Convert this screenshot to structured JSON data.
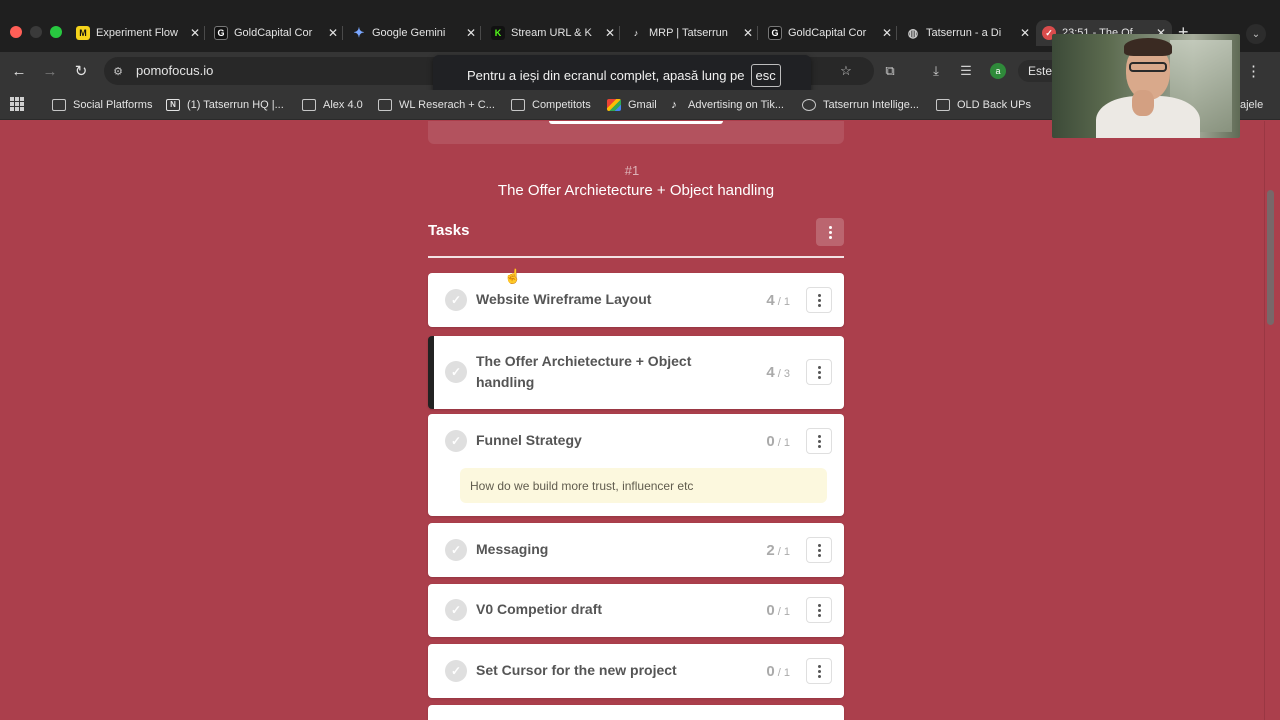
{
  "browser": {
    "tabs": [
      {
        "title": "Experiment Flow",
        "favicon": "miro-icon",
        "fav_bg": "#f5d31b",
        "fav_txt": "M",
        "active": false
      },
      {
        "title": "GoldCapital Cor",
        "favicon": "goldcapital-icon",
        "fav_bg": "#111111",
        "fav_txt": "G",
        "active": false
      },
      {
        "title": "Google Gemini",
        "favicon": "gemini-icon",
        "fav_bg": "#1f1f1f",
        "fav_txt": "✦",
        "active": false
      },
      {
        "title": "Stream URL & K",
        "favicon": "kick-icon",
        "fav_bg": "#111111",
        "fav_txt": "K",
        "active": false
      },
      {
        "title": "MRP | Tatserrun",
        "favicon": "tiktok-icon",
        "fav_bg": "#111111",
        "fav_txt": "♪",
        "active": false
      },
      {
        "title": "GoldCapital Cor",
        "favicon": "goldcapital-icon",
        "fav_bg": "#111111",
        "fav_txt": "G",
        "active": false
      },
      {
        "title": "Tatserrun - a Di",
        "favicon": "globe-icon",
        "fav_bg": "#1f1f1f",
        "fav_txt": "◍",
        "active": false
      },
      {
        "title": "23:51 - The Of",
        "favicon": "pomofocus-icon",
        "fav_bg": "#d94c4c",
        "fav_txt": "✓",
        "active": true
      }
    ],
    "url": "pomofocus.io",
    "fullscreen_notice": "Pentru a ieși din ecranul complet, apasă lung pe",
    "fullscreen_key": "esc",
    "profile_label": "Este",
    "bookmarks": [
      {
        "label": "Social Platforms",
        "icon": "folder"
      },
      {
        "label": "(1) Tatserrun HQ |...",
        "icon": "notion"
      },
      {
        "label": "Alex 4.0",
        "icon": "folder"
      },
      {
        "label": "WL Reserach + C...",
        "icon": "folder"
      },
      {
        "label": "Competitots",
        "icon": "folder"
      },
      {
        "label": "Gmail",
        "icon": "gmail"
      },
      {
        "label": "Advertising on Tik...",
        "icon": "tiktok"
      },
      {
        "label": "Tatserrun Intellige...",
        "icon": "globe"
      },
      {
        "label": "OLD Back UPs",
        "icon": "folder"
      },
      {
        "label": "ajele",
        "icon": "none"
      }
    ]
  },
  "app": {
    "session_number": "#1",
    "current_task": "The Offer Archietecture + Object handling",
    "tasks_title": "Tasks",
    "tasks": [
      {
        "name": "Website Wireframe Layout",
        "done": "4",
        "est": "/ 1",
        "note": ""
      },
      {
        "name": "The Offer Archietecture + Object handling",
        "done": "4",
        "est": "/ 3",
        "note": "",
        "active": true
      },
      {
        "name": "Funnel Strategy",
        "done": "0",
        "est": "/ 1",
        "note": "How do we build more trust, influencer etc"
      },
      {
        "name": "Messaging",
        "done": "2",
        "est": "/ 1",
        "note": ""
      },
      {
        "name": "V0 Competior draft",
        "done": "0",
        "est": "/ 1",
        "note": ""
      },
      {
        "name": "Set Cursor for the new project",
        "done": "0",
        "est": "/ 1",
        "note": ""
      }
    ]
  },
  "colors": {
    "background": "#ab3f4c",
    "task_card": "#ffffff",
    "note_bg": "#fcf8de",
    "browser_chrome": "#353535"
  }
}
